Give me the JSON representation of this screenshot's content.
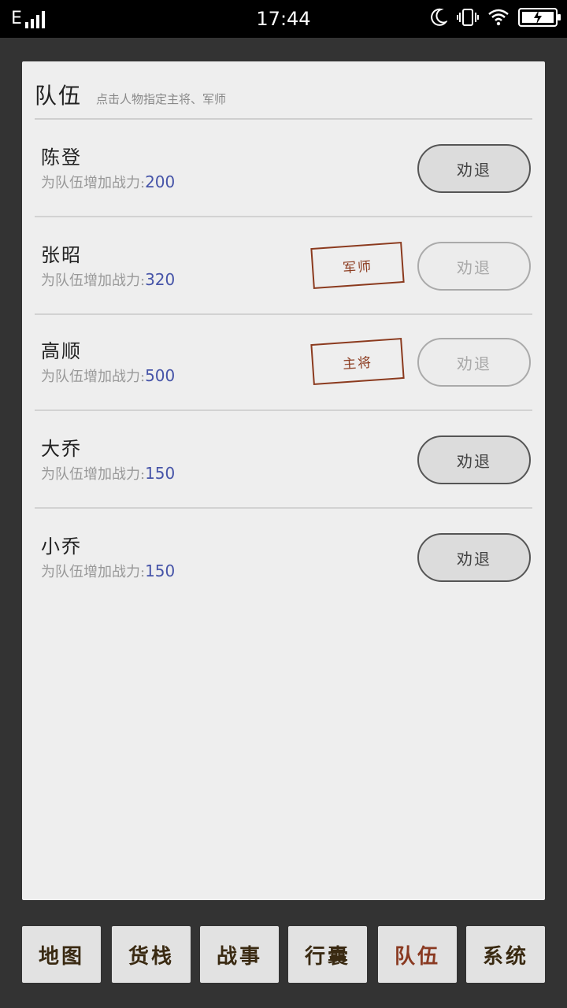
{
  "status_bar": {
    "network": "E",
    "time": "17:44"
  },
  "panel": {
    "title": "队伍",
    "subtitle": "点击人物指定主将、军师",
    "power_label": "为队伍增加战力:",
    "members": [
      {
        "name": "陈登",
        "power": "200",
        "role": "",
        "button": "劝退",
        "button_enabled": true
      },
      {
        "name": "张昭",
        "power": "320",
        "role": "军师",
        "button": "劝退",
        "button_enabled": false
      },
      {
        "name": "高顺",
        "power": "500",
        "role": "主将",
        "button": "劝退",
        "button_enabled": false
      },
      {
        "name": "大乔",
        "power": "150",
        "role": "",
        "button": "劝退",
        "button_enabled": true
      },
      {
        "name": "小乔",
        "power": "150",
        "role": "",
        "button": "劝退",
        "button_enabled": true
      }
    ]
  },
  "nav": {
    "tabs": [
      "地图",
      "货栈",
      "战事",
      "行囊",
      "队伍",
      "系统"
    ],
    "active": "队伍"
  },
  "colors": {
    "background": "#333333",
    "panel": "#eeeeee",
    "power_value": "#4654a8",
    "stamp": "#8b3a1e",
    "active_tab": "#8a3a22"
  }
}
